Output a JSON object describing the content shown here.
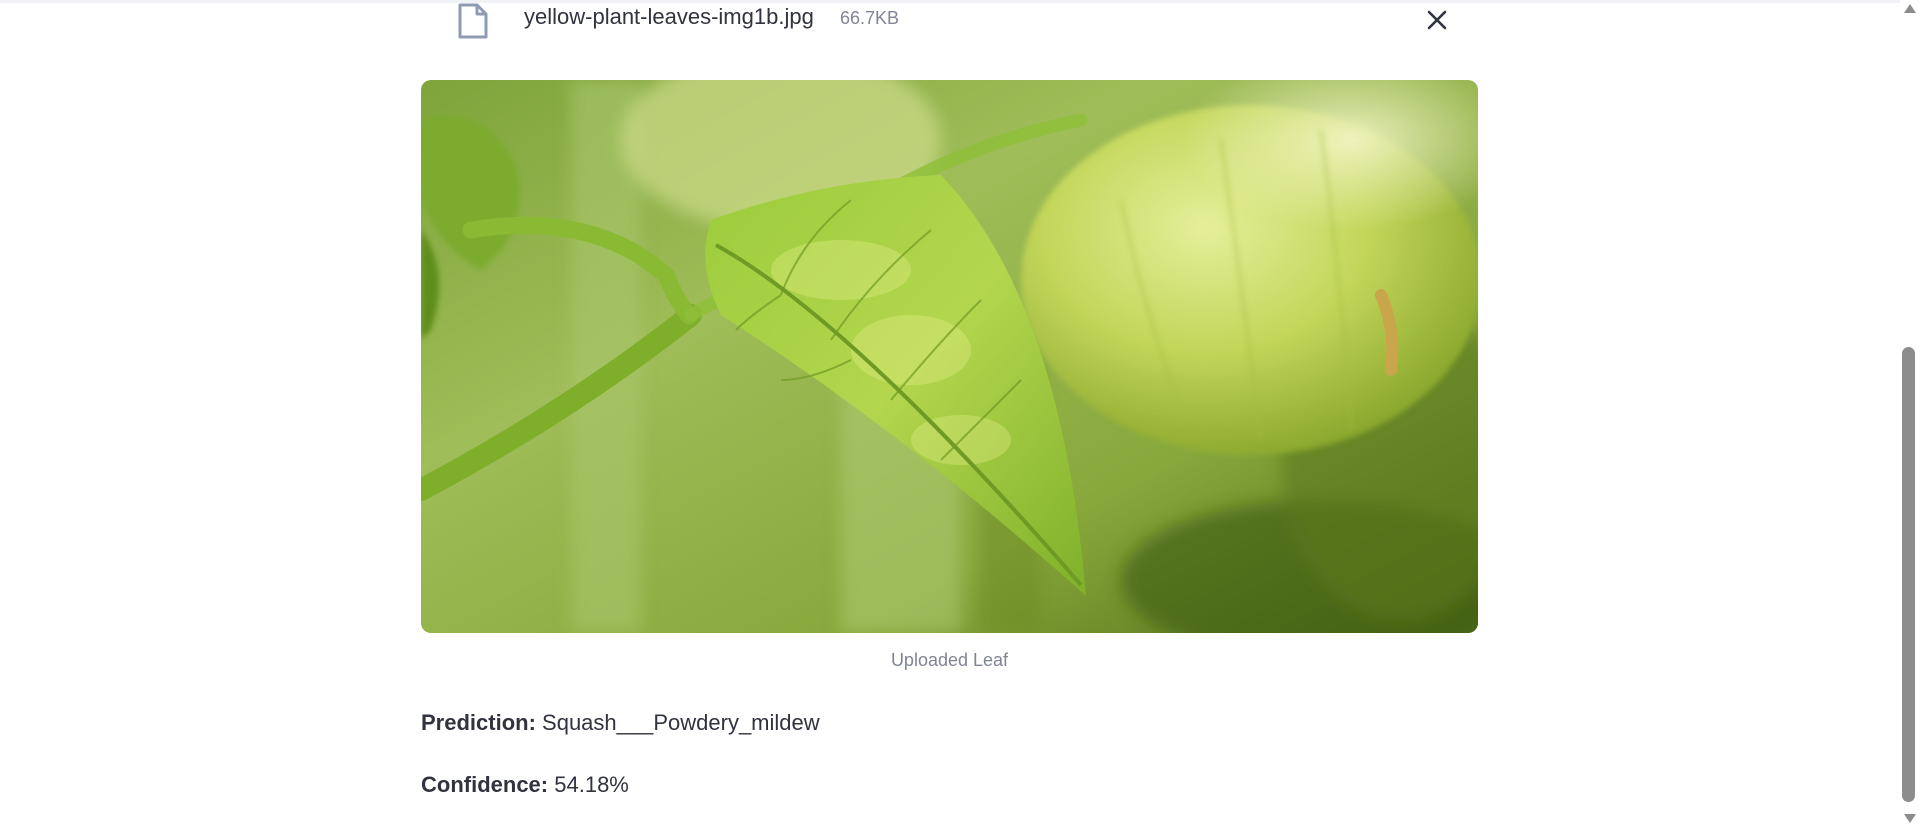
{
  "uploaded_file": {
    "name": "yellow-plant-leaves-img1b.jpg",
    "size": "66.7KB",
    "file_icon": "file-icon",
    "remove_icon": "close-icon"
  },
  "image": {
    "caption": "Uploaded Leaf"
  },
  "result": {
    "prediction_label": "Prediction:",
    "prediction_value": "Squash___Powdery_mildew",
    "confidence_label": "Confidence:",
    "confidence_value": "54.18%"
  },
  "colors": {
    "text": "#31333f",
    "muted": "#808495",
    "file_icon": "#8f9bb3",
    "scrollbar": "#8c8c8c"
  }
}
